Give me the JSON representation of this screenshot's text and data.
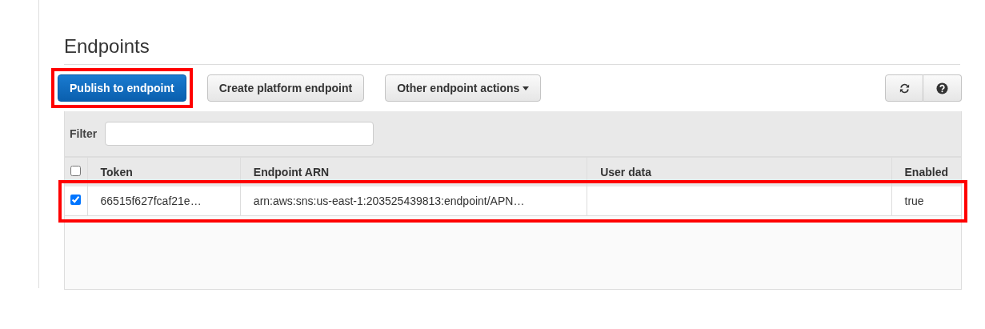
{
  "section": {
    "title": "Endpoints"
  },
  "toolbar": {
    "buttons": [
      {
        "label": "Publish to endpoint",
        "kind": "primary",
        "highlighted": true
      },
      {
        "label": "Create platform endpoint",
        "kind": "default",
        "highlighted": false
      },
      {
        "label": "Other endpoint actions",
        "kind": "dropdown",
        "highlighted": false
      }
    ]
  },
  "filter": {
    "label": "Filter"
  },
  "table": {
    "select_all": {
      "checked": false
    },
    "columns": [
      "Token",
      "Endpoint ARN",
      "User data",
      "Enabled"
    ],
    "rows": [
      {
        "selected": true,
        "highlighted": true,
        "cells": [
          "66515f627fcaf21e…",
          "arn:aws:sns:us-east-1:203525439813:endpoint/APN…",
          "",
          "true"
        ]
      }
    ]
  }
}
